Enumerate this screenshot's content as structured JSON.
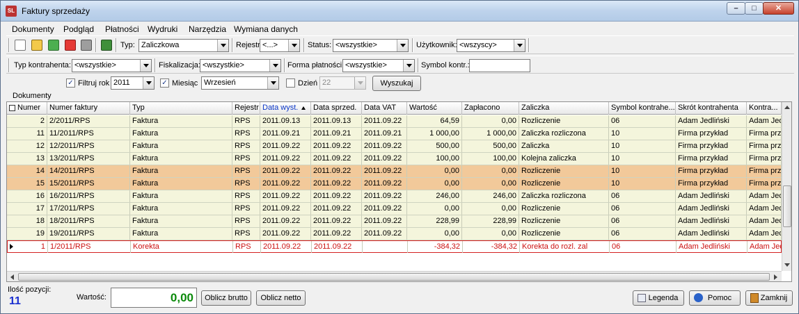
{
  "window": {
    "title": "Faktury sprzedaży",
    "min": "–",
    "max": "□",
    "close": "✕",
    "app_icon": "SL"
  },
  "menu": [
    "Dokumenty",
    "Podgląd",
    "Płatności",
    "Wydruki",
    "Narzędzia",
    "Wymiana danych"
  ],
  "toolbar": {
    "icons": [
      "new-document-icon",
      "edit-icon",
      "add-icon",
      "delete-icon",
      "print-icon",
      "export-icon"
    ],
    "typ_label": "Typ:",
    "typ_value": "Zaliczkowa",
    "rejestr_label": "Rejestr:",
    "rejestr_value": "<...>",
    "status_label": "Status:",
    "status_value": "<wszystkie>",
    "uzytkownik_label": "Użytkownik:",
    "uzytkownik_value": "<wszyscy>"
  },
  "filters": {
    "typ_kontrahenta_label": "Typ kontrahenta:",
    "typ_kontrahenta_value": "<wszystkie>",
    "fiskalizacja_label": "Fiskalizacja:",
    "fiskalizacja_value": "<wszystkie>",
    "forma_platnosci_label": "Forma płatności:",
    "forma_platnosci_value": "<wszystkie>",
    "symbol_label": "Symbol kontr.:",
    "symbol_value": "",
    "filtruj_rok_label": "Filtruj rok",
    "rok_value": "2011",
    "miesiac_label": "Miesiąc",
    "miesiac_value": "Wrzesień",
    "dzien_label": "Dzień",
    "dzien_value": "22",
    "wyszukaj": "Wyszukaj"
  },
  "group_label": "Dokumenty",
  "columns": [
    "Numer",
    "Numer faktury",
    "Typ",
    "Rejestr",
    "Data wyst.",
    "Data sprzed.",
    "Data VAT",
    "Wartość",
    "Zapłacono",
    "Zaliczka",
    "Symbol kontrahe...",
    "Skrót kontrahenta",
    "Kontra..."
  ],
  "rows": [
    {
      "c": [
        "2",
        "2/2011/RPS",
        "Faktura",
        "RPS",
        "2011.09.13",
        "2011.09.13",
        "2011.09.22",
        "64,59",
        "0,00",
        "Rozliczenie",
        "06",
        "Adam Jedliński",
        "Adam Jed"
      ],
      "bg": "#f4f5dc"
    },
    {
      "c": [
        "11",
        "11/2011/RPS",
        "Faktura",
        "RPS",
        "2011.09.21",
        "2011.09.21",
        "2011.09.21",
        "1 000,00",
        "1 000,00",
        "Zaliczka rozliczona",
        "10",
        "Firma przykład",
        "Firma przy"
      ],
      "bg": "#f4f5dc"
    },
    {
      "c": [
        "12",
        "12/2011/RPS",
        "Faktura",
        "RPS",
        "2011.09.22",
        "2011.09.22",
        "2011.09.22",
        "500,00",
        "500,00",
        "Zaliczka",
        "10",
        "Firma przykład",
        "Firma przy"
      ],
      "bg": "#f4f5dc"
    },
    {
      "c": [
        "13",
        "13/2011/RPS",
        "Faktura",
        "RPS",
        "2011.09.22",
        "2011.09.22",
        "2011.09.22",
        "100,00",
        "100,00",
        "Kolejna zaliczka",
        "10",
        "Firma przykład",
        "Firma przy"
      ],
      "bg": "#f4f5dc"
    },
    {
      "c": [
        "14",
        "14/2011/RPS",
        "Faktura",
        "RPS",
        "2011.09.22",
        "2011.09.22",
        "2011.09.22",
        "0,00",
        "0,00",
        "Rozliczenie",
        "10",
        "Firma przykład",
        "Firma przy"
      ],
      "bg": "#f2c99a"
    },
    {
      "c": [
        "15",
        "15/2011/RPS",
        "Faktura",
        "RPS",
        "2011.09.22",
        "2011.09.22",
        "2011.09.22",
        "0,00",
        "0,00",
        "Rozliczenie",
        "10",
        "Firma przykład",
        "Firma przy"
      ],
      "bg": "#f2c99a"
    },
    {
      "c": [
        "16",
        "16/2011/RPS",
        "Faktura",
        "RPS",
        "2011.09.22",
        "2011.09.22",
        "2011.09.22",
        "246,00",
        "246,00",
        "Zaliczka rozliczona",
        "06",
        "Adam Jedliński",
        "Adam Jed"
      ],
      "bg": "#f4f5dc"
    },
    {
      "c": [
        "17",
        "17/2011/RPS",
        "Faktura",
        "RPS",
        "2011.09.22",
        "2011.09.22",
        "2011.09.22",
        "0,00",
        "0,00",
        "Rozliczenie",
        "06",
        "Adam Jedliński",
        "Adam Jed"
      ],
      "bg": "#f4f5dc"
    },
    {
      "c": [
        "18",
        "18/2011/RPS",
        "Faktura",
        "RPS",
        "2011.09.22",
        "2011.09.22",
        "2011.09.22",
        "228,99",
        "228,99",
        "Rozliczenie",
        "06",
        "Adam Jedliński",
        "Adam Jed"
      ],
      "bg": "#f4f5dc"
    },
    {
      "c": [
        "19",
        "19/2011/RPS",
        "Faktura",
        "RPS",
        "2011.09.22",
        "2011.09.22",
        "2011.09.22",
        "0,00",
        "0,00",
        "Rozliczenie",
        "06",
        "Adam Jedliński",
        "Adam Jed"
      ],
      "bg": "#f4f5dc"
    },
    {
      "c": [
        "1",
        "1/2011/RPS",
        "Korekta",
        "RPS",
        "2011.09.22",
        "2011.09.22",
        "",
        "-384,32",
        "-384,32",
        "Korekta do rozl. zal",
        "06",
        "Adam Jedliński",
        "Adam Jed"
      ],
      "bg": "#ffffff",
      "selected": true,
      "color": "#cc1010"
    }
  ],
  "footer": {
    "ilosc_label": "Ilość pozycji:",
    "ilosc_value": "11",
    "wartosc_label": "Wartość:",
    "wartosc_value": "0,00",
    "oblicz_brutto": "Oblicz brutto",
    "oblicz_netto": "Oblicz netto",
    "legenda": "Legenda",
    "pomoc": "Pomoc",
    "zamknij": "Zamknij"
  },
  "colors": {
    "ilosc": "#1a2fd0",
    "wartosc": "#0b8a0b",
    "highlight": "#f2c99a",
    "row": "#f4f5dc",
    "selected_text": "#cc1010"
  }
}
